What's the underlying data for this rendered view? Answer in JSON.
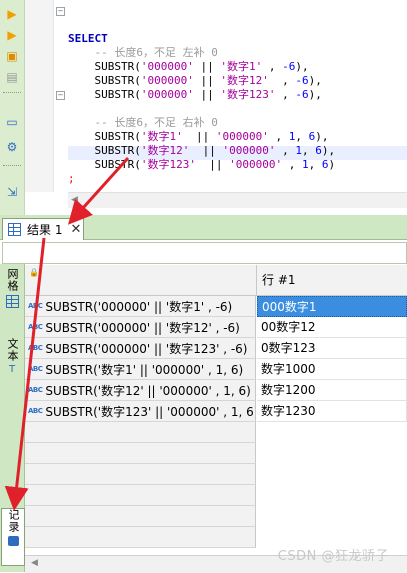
{
  "editor": {
    "lines": [
      [
        {
          "t": "SELECT",
          "c": "kw"
        }
      ],
      [
        {
          "t": "    -- 长度6，不足 左补 0",
          "c": "cm"
        }
      ],
      [
        {
          "t": "    SUBSTR(",
          "c": "fn"
        },
        {
          "t": "'000000'",
          "c": "str"
        },
        {
          "t": " || ",
          "c": "pun"
        },
        {
          "t": "'数字1'",
          "c": "str"
        },
        {
          "t": " , ",
          "c": "pun"
        },
        {
          "t": "-6",
          "c": "num"
        },
        {
          "t": "),",
          "c": "pun"
        }
      ],
      [
        {
          "t": "    SUBSTR(",
          "c": "fn"
        },
        {
          "t": "'000000'",
          "c": "str"
        },
        {
          "t": " || ",
          "c": "pun"
        },
        {
          "t": "'数字12'",
          "c": "str"
        },
        {
          "t": "  , ",
          "c": "pun"
        },
        {
          "t": "-6",
          "c": "num"
        },
        {
          "t": "),",
          "c": "pun"
        }
      ],
      [
        {
          "t": "    SUBSTR(",
          "c": "fn"
        },
        {
          "t": "'000000'",
          "c": "str"
        },
        {
          "t": " || ",
          "c": "pun"
        },
        {
          "t": "'数字123'",
          "c": "str"
        },
        {
          "t": " , ",
          "c": "pun"
        },
        {
          "t": "-6",
          "c": "num"
        },
        {
          "t": "),",
          "c": "pun"
        }
      ],
      [
        {
          "t": "",
          "c": "pun"
        }
      ],
      [
        {
          "t": "    -- 长度6，不足 右补 0",
          "c": "cm"
        }
      ],
      [
        {
          "t": "    SUBSTR(",
          "c": "fn"
        },
        {
          "t": "'数字1'",
          "c": "str"
        },
        {
          "t": "  || ",
          "c": "pun"
        },
        {
          "t": "'000000'",
          "c": "str"
        },
        {
          "t": " , ",
          "c": "pun"
        },
        {
          "t": "1",
          "c": "num"
        },
        {
          "t": ", ",
          "c": "pun"
        },
        {
          "t": "6",
          "c": "num"
        },
        {
          "t": "),",
          "c": "pun"
        }
      ],
      [
        {
          "t": "    SUBSTR(",
          "c": "fn"
        },
        {
          "t": "'数字12'",
          "c": "str"
        },
        {
          "t": "  || ",
          "c": "pun"
        },
        {
          "t": "'000000'",
          "c": "str"
        },
        {
          "t": " , ",
          "c": "pun"
        },
        {
          "t": "1",
          "c": "num"
        },
        {
          "t": ", ",
          "c": "pun"
        },
        {
          "t": "6",
          "c": "num"
        },
        {
          "t": "),",
          "c": "pun"
        }
      ],
      [
        {
          "t": "    SUBSTR(",
          "c": "fn"
        },
        {
          "t": "'数字123'",
          "c": "str"
        },
        {
          "t": "  || ",
          "c": "pun"
        },
        {
          "t": "'000000'",
          "c": "str"
        },
        {
          "t": " , ",
          "c": "pun"
        },
        {
          "t": "1",
          "c": "num"
        },
        {
          "t": ", ",
          "c": "pun"
        },
        {
          "t": "6",
          "c": "num"
        },
        {
          "t": ")",
          "c": "pun"
        }
      ],
      [
        {
          "t": ";",
          "c": "semi"
        }
      ]
    ]
  },
  "result_tab": {
    "label": "结果 1",
    "close": "✕"
  },
  "side_tabs": [
    {
      "label": "网格",
      "icon": "grid-icon"
    },
    {
      "label": "文本",
      "icon": "text-icon"
    },
    {
      "label": "记录",
      "icon": "record-icon"
    }
  ],
  "grid": {
    "column_header": "行 #1",
    "rows": [
      {
        "header": "SUBSTR('000000' || '数字1' , -6)",
        "value": "000数字1",
        "selected": true
      },
      {
        "header": "SUBSTR('000000' || '数字12'  , -6)",
        "value": "00数字12",
        "selected": false
      },
      {
        "header": "SUBSTR('000000' || '数字123' , -6)",
        "value": "0数字123",
        "selected": false
      },
      {
        "header": "SUBSTR('数字1' || '000000' , 1, 6)",
        "value": "数字1000",
        "selected": false
      },
      {
        "header": "SUBSTR('数字12'  || '000000' , 1, 6)",
        "value": "数字1200",
        "selected": false
      },
      {
        "header": "SUBSTR('数字123'  || '000000' , 1, 6)",
        "value": "数字1230",
        "selected": false
      }
    ],
    "empty_rows": 6
  },
  "watermark": "CSDN @狂龙骄子",
  "colors": {
    "accent": "#3a8ddf",
    "annotation": "#e0202a",
    "toolbar_bg": "#dbeccf"
  }
}
